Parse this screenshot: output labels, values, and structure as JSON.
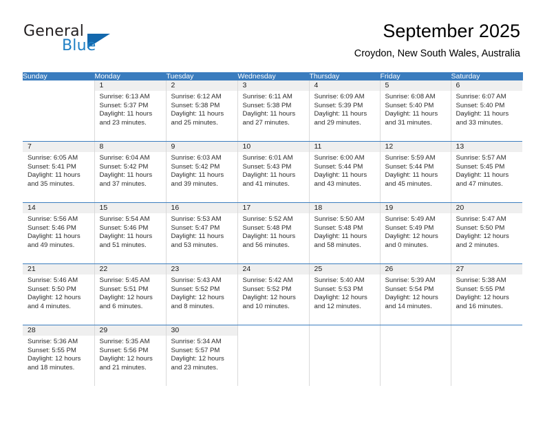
{
  "brand": {
    "name_part1": "General",
    "name_part2": "Blue",
    "triangle_icon": "triangle-icon",
    "accent_color": "#1368ad",
    "blue_text_color": "#1f7fc4"
  },
  "header": {
    "title": "September 2025",
    "subtitle": "Croydon, New South Wales, Australia"
  },
  "calendar": {
    "header_bg": "#3a7cbe",
    "daynum_band_bg": "#efefef",
    "weekday_headers": [
      "Sunday",
      "Monday",
      "Tuesday",
      "Wednesday",
      "Thursday",
      "Friday",
      "Saturday"
    ],
    "weeks": [
      [
        {
          "day": "",
          "sunrise": "",
          "sunset": "",
          "daylight": "",
          "empty": true
        },
        {
          "day": "1",
          "sunrise": "Sunrise: 6:13 AM",
          "sunset": "Sunset: 5:37 PM",
          "daylight": "Daylight: 11 hours and 23 minutes."
        },
        {
          "day": "2",
          "sunrise": "Sunrise: 6:12 AM",
          "sunset": "Sunset: 5:38 PM",
          "daylight": "Daylight: 11 hours and 25 minutes."
        },
        {
          "day": "3",
          "sunrise": "Sunrise: 6:11 AM",
          "sunset": "Sunset: 5:38 PM",
          "daylight": "Daylight: 11 hours and 27 minutes."
        },
        {
          "day": "4",
          "sunrise": "Sunrise: 6:09 AM",
          "sunset": "Sunset: 5:39 PM",
          "daylight": "Daylight: 11 hours and 29 minutes."
        },
        {
          "day": "5",
          "sunrise": "Sunrise: 6:08 AM",
          "sunset": "Sunset: 5:40 PM",
          "daylight": "Daylight: 11 hours and 31 minutes."
        },
        {
          "day": "6",
          "sunrise": "Sunrise: 6:07 AM",
          "sunset": "Sunset: 5:40 PM",
          "daylight": "Daylight: 11 hours and 33 minutes."
        }
      ],
      [
        {
          "day": "7",
          "sunrise": "Sunrise: 6:05 AM",
          "sunset": "Sunset: 5:41 PM",
          "daylight": "Daylight: 11 hours and 35 minutes."
        },
        {
          "day": "8",
          "sunrise": "Sunrise: 6:04 AM",
          "sunset": "Sunset: 5:42 PM",
          "daylight": "Daylight: 11 hours and 37 minutes."
        },
        {
          "day": "9",
          "sunrise": "Sunrise: 6:03 AM",
          "sunset": "Sunset: 5:42 PM",
          "daylight": "Daylight: 11 hours and 39 minutes."
        },
        {
          "day": "10",
          "sunrise": "Sunrise: 6:01 AM",
          "sunset": "Sunset: 5:43 PM",
          "daylight": "Daylight: 11 hours and 41 minutes."
        },
        {
          "day": "11",
          "sunrise": "Sunrise: 6:00 AM",
          "sunset": "Sunset: 5:44 PM",
          "daylight": "Daylight: 11 hours and 43 minutes."
        },
        {
          "day": "12",
          "sunrise": "Sunrise: 5:59 AM",
          "sunset": "Sunset: 5:44 PM",
          "daylight": "Daylight: 11 hours and 45 minutes."
        },
        {
          "day": "13",
          "sunrise": "Sunrise: 5:57 AM",
          "sunset": "Sunset: 5:45 PM",
          "daylight": "Daylight: 11 hours and 47 minutes."
        }
      ],
      [
        {
          "day": "14",
          "sunrise": "Sunrise: 5:56 AM",
          "sunset": "Sunset: 5:46 PM",
          "daylight": "Daylight: 11 hours and 49 minutes."
        },
        {
          "day": "15",
          "sunrise": "Sunrise: 5:54 AM",
          "sunset": "Sunset: 5:46 PM",
          "daylight": "Daylight: 11 hours and 51 minutes."
        },
        {
          "day": "16",
          "sunrise": "Sunrise: 5:53 AM",
          "sunset": "Sunset: 5:47 PM",
          "daylight": "Daylight: 11 hours and 53 minutes."
        },
        {
          "day": "17",
          "sunrise": "Sunrise: 5:52 AM",
          "sunset": "Sunset: 5:48 PM",
          "daylight": "Daylight: 11 hours and 56 minutes."
        },
        {
          "day": "18",
          "sunrise": "Sunrise: 5:50 AM",
          "sunset": "Sunset: 5:48 PM",
          "daylight": "Daylight: 11 hours and 58 minutes."
        },
        {
          "day": "19",
          "sunrise": "Sunrise: 5:49 AM",
          "sunset": "Sunset: 5:49 PM",
          "daylight": "Daylight: 12 hours and 0 minutes."
        },
        {
          "day": "20",
          "sunrise": "Sunrise: 5:47 AM",
          "sunset": "Sunset: 5:50 PM",
          "daylight": "Daylight: 12 hours and 2 minutes."
        }
      ],
      [
        {
          "day": "21",
          "sunrise": "Sunrise: 5:46 AM",
          "sunset": "Sunset: 5:50 PM",
          "daylight": "Daylight: 12 hours and 4 minutes."
        },
        {
          "day": "22",
          "sunrise": "Sunrise: 5:45 AM",
          "sunset": "Sunset: 5:51 PM",
          "daylight": "Daylight: 12 hours and 6 minutes."
        },
        {
          "day": "23",
          "sunrise": "Sunrise: 5:43 AM",
          "sunset": "Sunset: 5:52 PM",
          "daylight": "Daylight: 12 hours and 8 minutes."
        },
        {
          "day": "24",
          "sunrise": "Sunrise: 5:42 AM",
          "sunset": "Sunset: 5:52 PM",
          "daylight": "Daylight: 12 hours and 10 minutes."
        },
        {
          "day": "25",
          "sunrise": "Sunrise: 5:40 AM",
          "sunset": "Sunset: 5:53 PM",
          "daylight": "Daylight: 12 hours and 12 minutes."
        },
        {
          "day": "26",
          "sunrise": "Sunrise: 5:39 AM",
          "sunset": "Sunset: 5:54 PM",
          "daylight": "Daylight: 12 hours and 14 minutes."
        },
        {
          "day": "27",
          "sunrise": "Sunrise: 5:38 AM",
          "sunset": "Sunset: 5:55 PM",
          "daylight": "Daylight: 12 hours and 16 minutes."
        }
      ],
      [
        {
          "day": "28",
          "sunrise": "Sunrise: 5:36 AM",
          "sunset": "Sunset: 5:55 PM",
          "daylight": "Daylight: 12 hours and 18 minutes."
        },
        {
          "day": "29",
          "sunrise": "Sunrise: 5:35 AM",
          "sunset": "Sunset: 5:56 PM",
          "daylight": "Daylight: 12 hours and 21 minutes."
        },
        {
          "day": "30",
          "sunrise": "Sunrise: 5:34 AM",
          "sunset": "Sunset: 5:57 PM",
          "daylight": "Daylight: 12 hours and 23 minutes."
        },
        {
          "day": "",
          "sunrise": "",
          "sunset": "",
          "daylight": "",
          "empty": true
        },
        {
          "day": "",
          "sunrise": "",
          "sunset": "",
          "daylight": "",
          "empty": true
        },
        {
          "day": "",
          "sunrise": "",
          "sunset": "",
          "daylight": "",
          "empty": true
        },
        {
          "day": "",
          "sunrise": "",
          "sunset": "",
          "daylight": "",
          "empty": true
        }
      ]
    ]
  }
}
